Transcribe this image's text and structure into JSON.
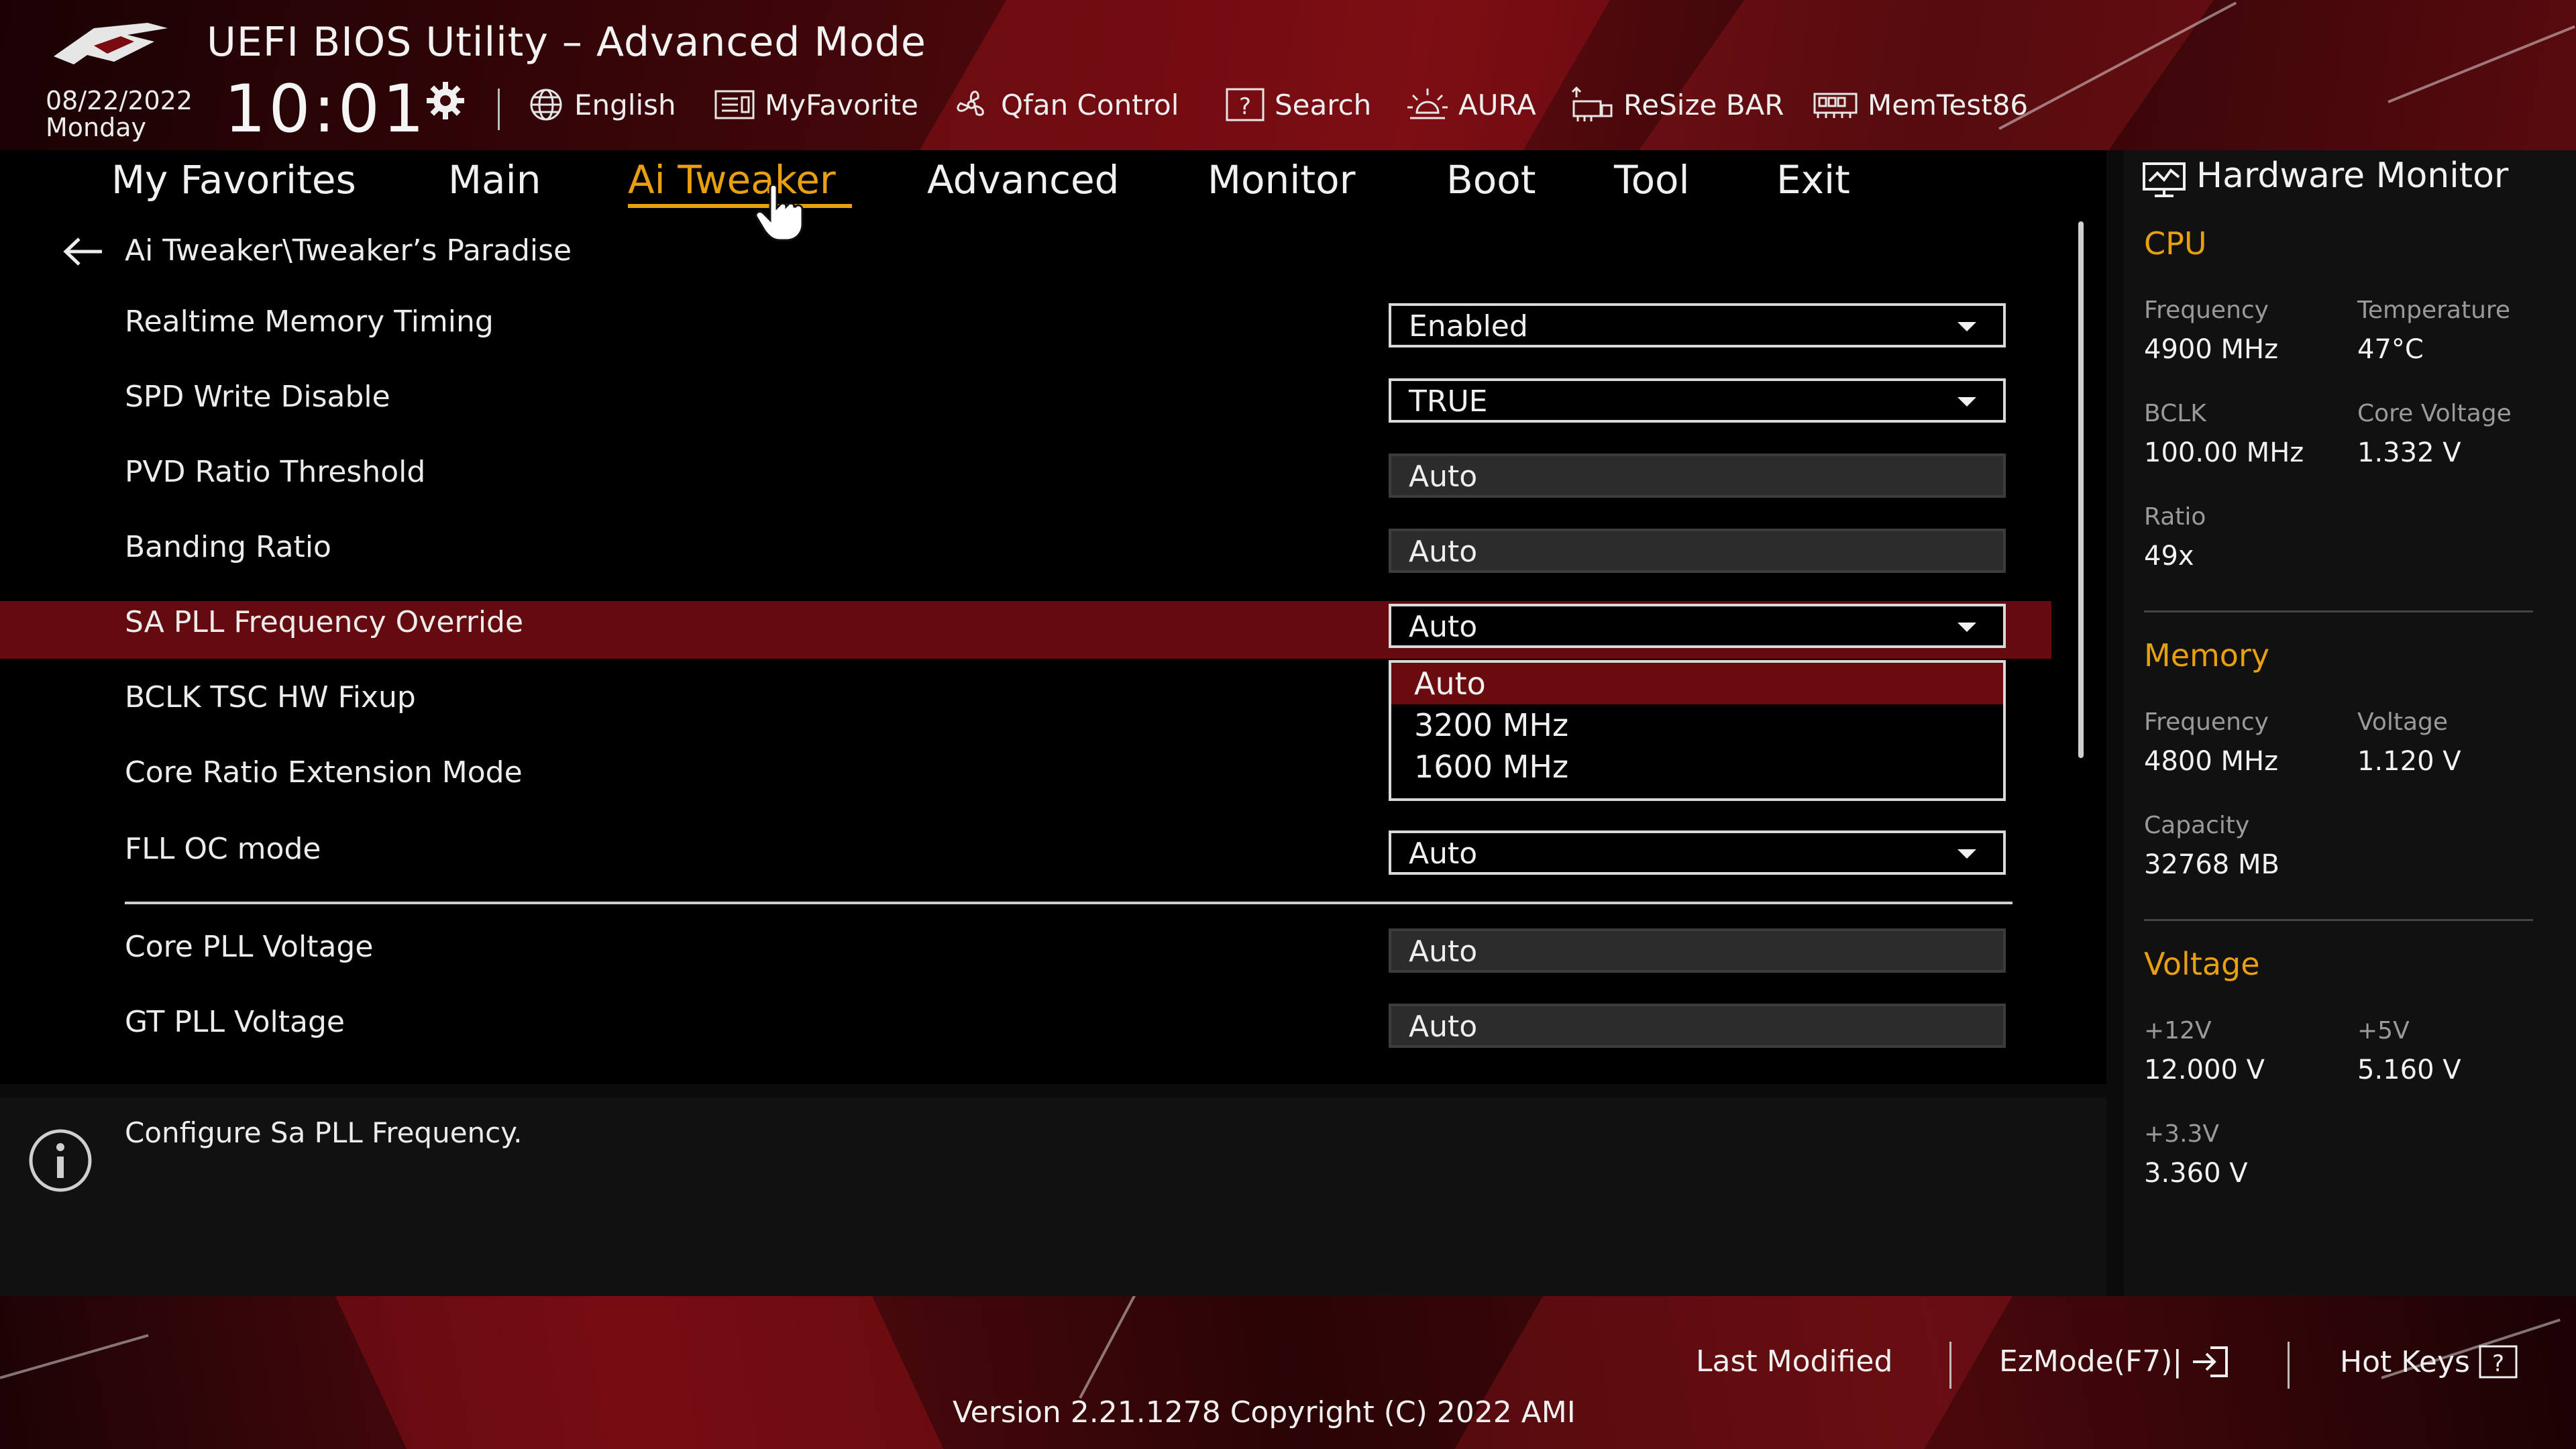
{
  "header": {
    "title": "UEFI BIOS Utility – Advanced Mode",
    "date": "08/22/2022",
    "day": "Monday",
    "time": "10:01"
  },
  "toolbar": [
    {
      "label": "English",
      "icon": "globe-icon"
    },
    {
      "label": "MyFavorite",
      "icon": "favorite-icon"
    },
    {
      "label": "Qfan Control",
      "icon": "fan-icon"
    },
    {
      "label": "Search",
      "icon": "search-icon"
    },
    {
      "label": "AURA",
      "icon": "aura-icon"
    },
    {
      "label": "ReSize BAR",
      "icon": "resize-bar-icon"
    },
    {
      "label": "MemTest86",
      "icon": "memtest-icon"
    }
  ],
  "tabs": [
    "My Favorites",
    "Main",
    "Ai Tweaker",
    "Advanced",
    "Monitor",
    "Boot",
    "Tool",
    "Exit"
  ],
  "active_tab": "Ai Tweaker",
  "breadcrumb": "Ai Tweaker\\Tweaker’s Paradise",
  "settings": [
    {
      "label": "Realtime Memory Timing",
      "value": "Enabled",
      "type": "dropdown"
    },
    {
      "label": "SPD Write Disable",
      "value": "TRUE",
      "type": "dropdown"
    },
    {
      "label": "PVD Ratio Threshold",
      "value": "Auto",
      "type": "input"
    },
    {
      "label": "Banding Ratio",
      "value": "Auto",
      "type": "input"
    },
    {
      "label": "SA PLL Frequency Override",
      "value": "Auto",
      "type": "dropdown"
    },
    {
      "label": "BCLK TSC HW Fixup",
      "value": "",
      "type": "hidden"
    },
    {
      "label": "Core Ratio Extension Mode",
      "value": "",
      "type": "hidden"
    },
    {
      "label": "FLL OC mode",
      "value": "Auto",
      "type": "dropdown"
    },
    {
      "label": "Core PLL Voltage",
      "value": "Auto",
      "type": "input"
    },
    {
      "label": "GT PLL Voltage",
      "value": "Auto",
      "type": "input"
    }
  ],
  "dropdown_options": [
    "Auto",
    "3200 MHz",
    "1600 MHz"
  ],
  "dropdown_selected": "Auto",
  "info_text": "Configure Sa PLL Frequency.",
  "hardware_monitor": {
    "title": "Hardware Monitor",
    "cpu": {
      "section": "CPU",
      "frequency_label": "Frequency",
      "frequency": "4900 MHz",
      "temperature_label": "Temperature",
      "temperature": "47°C",
      "bclk_label": "BCLK",
      "bclk": "100.00 MHz",
      "core_voltage_label": "Core Voltage",
      "core_voltage": "1.332 V",
      "ratio_label": "Ratio",
      "ratio": "49x"
    },
    "memory": {
      "section": "Memory",
      "frequency_label": "Frequency",
      "frequency": "4800 MHz",
      "voltage_label": "Voltage",
      "voltage": "1.120 V",
      "capacity_label": "Capacity",
      "capacity": "32768 MB"
    },
    "voltage": {
      "section": "Voltage",
      "v12_label": "+12V",
      "v12": "12.000 V",
      "v5_label": "+5V",
      "v5": "5.160 V",
      "v33_label": "+3.3V",
      "v33": "3.360 V"
    }
  },
  "footer": {
    "last_modified": "Last Modified",
    "ezmode": "EzMode(F7)|",
    "hot_keys": "Hot Keys",
    "version": "Version 2.21.1278 Copyright (C) 2022 AMI"
  },
  "colors": {
    "accent": "#e8a010",
    "highlight": "#650a0f",
    "background": "#000000",
    "panel": "#111111"
  }
}
